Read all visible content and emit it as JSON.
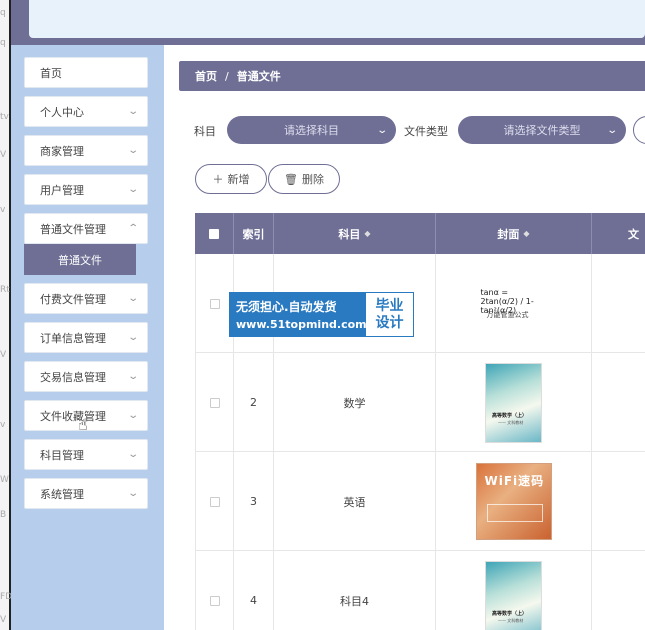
{
  "background_strip": [
    "q",
    "q",
    "tv",
    "V",
    "v",
    "Rt",
    "V",
    "v",
    "W",
    "B",
    "FD",
    "V"
  ],
  "sidebar": {
    "items": [
      {
        "label": "首页"
      },
      {
        "label": "个人中心"
      },
      {
        "label": "商家管理"
      },
      {
        "label": "用户管理"
      },
      {
        "label": "普通文件管理"
      },
      {
        "label": "付费文件管理"
      },
      {
        "label": "订单信息管理"
      },
      {
        "label": "交易信息管理"
      },
      {
        "label": "文件收藏管理"
      },
      {
        "label": "科目管理"
      },
      {
        "label": "系统管理"
      }
    ],
    "active_sub": "普通文件"
  },
  "breadcrumb": {
    "home": "首页",
    "sep": "/",
    "current": "普通文件"
  },
  "filters": {
    "subject_label": "科目",
    "subject_placeholder": "请选择科目",
    "type_label": "文件类型",
    "type_placeholder": "请选择文件类型"
  },
  "actions": {
    "add": "新增",
    "delete": "删除"
  },
  "table": {
    "headers": {
      "index": "索引",
      "subject": "科目",
      "cover": "封面",
      "partial": "文"
    },
    "rows": [
      {
        "index": "",
        "subject": "",
        "cover": "formula"
      },
      {
        "index": "2",
        "subject": "数学",
        "cover": "book"
      },
      {
        "index": "3",
        "subject": "英语",
        "cover": "wifi"
      },
      {
        "index": "4",
        "subject": "科目4",
        "cover": "book"
      }
    ],
    "cover_text": {
      "formula_line": "tanα = 2tan(α/2) / 1-tan²(α/2)",
      "formula_caption": "万能管道公式",
      "book_title": "高等数学（上）",
      "book_sub": "—— 文科教材",
      "wifi_title": "WiFi速码"
    }
  },
  "watermark": {
    "line1": "无须担心.自动发货",
    "line2": "www.51topmind.com",
    "right1": "毕业",
    "right2": "设计"
  },
  "colors": {
    "accent": "#6f6f95",
    "sidebar_bg": "#b6cdec",
    "header_bg": "#e8f2fb",
    "watermark": "#2a7ac1"
  }
}
